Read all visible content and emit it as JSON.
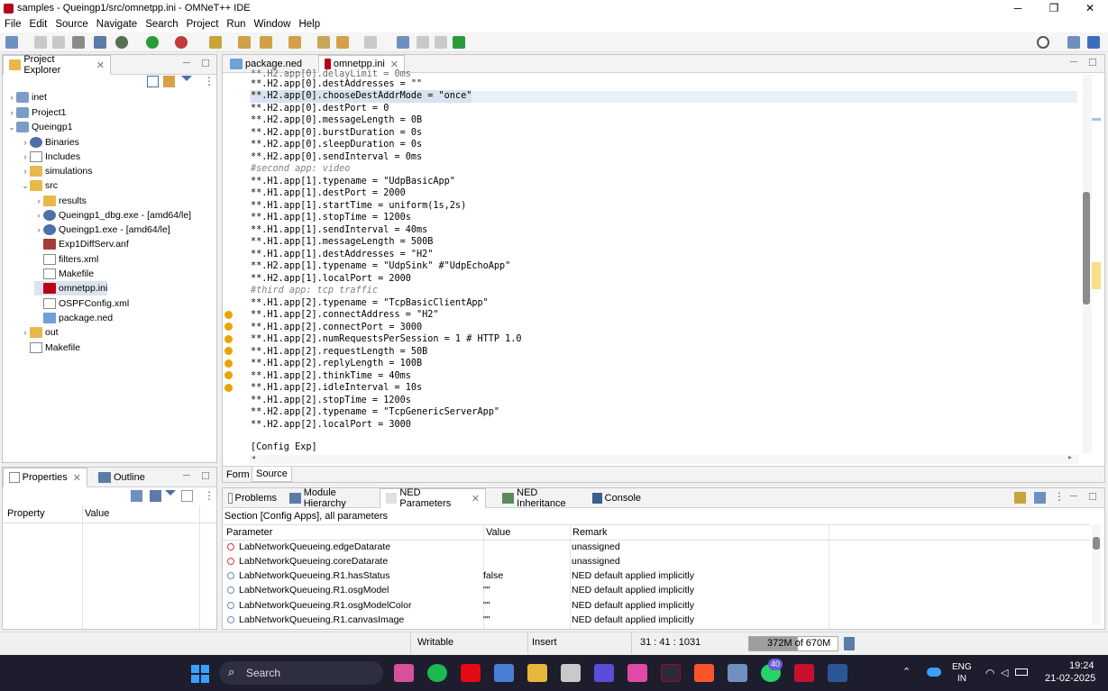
{
  "window": {
    "title": "samples - Queingp1/src/omnetpp.ini - OMNeT++ IDE",
    "minimize": "─",
    "maximize": "❐",
    "close": "✕"
  },
  "menu": [
    "File",
    "Edit",
    "Source",
    "Navigate",
    "Search",
    "Project",
    "Run",
    "Window",
    "Help"
  ],
  "project_explorer": {
    "tab_label": "Project Explorer",
    "items": [
      {
        "label": "inet",
        "arrow": "›"
      },
      {
        "label": "Project1",
        "arrow": "›"
      },
      {
        "label": "Queingp1",
        "arrow": "⌄"
      },
      {
        "label": "Binaries",
        "arrow": "›"
      },
      {
        "label": "Includes",
        "arrow": "›"
      },
      {
        "label": "simulations",
        "arrow": "›"
      },
      {
        "label": "src",
        "arrow": "⌄"
      },
      {
        "label": "results",
        "arrow": "›"
      },
      {
        "label": "Queingp1_dbg.exe - [amd64/le]",
        "arrow": "›"
      },
      {
        "label": "Queingp1.exe - [amd64/le]",
        "arrow": "›"
      },
      {
        "label": "Exp1DiffServ.anf",
        "arrow": ""
      },
      {
        "label": "filters.xml",
        "arrow": ""
      },
      {
        "label": "Makefile",
        "arrow": ""
      },
      {
        "label": "omnetpp.ini",
        "arrow": ""
      },
      {
        "label": "OSPFConfig.xml",
        "arrow": ""
      },
      {
        "label": "package.ned",
        "arrow": ""
      },
      {
        "label": "out",
        "arrow": "›"
      },
      {
        "label": "Makefile",
        "arrow": ""
      }
    ]
  },
  "properties": {
    "tab_label": "Properties",
    "outline_tab_label": "Outline",
    "col_property": "Property",
    "col_value": "Value"
  },
  "editor": {
    "tabs": [
      "package.ned",
      "omnetpp.ini"
    ],
    "bottom_tabs": [
      "Form",
      "Source"
    ],
    "lines": [
      "**.H2.app[0].destAddresses = \"\"",
      "**.H2.app[0].chooseDestAddrMode = \"once\"",
      "**.H2.app[0].destPort = 0",
      "**.H2.app[0].messageLength = 0B",
      "**.H2.app[0].burstDuration = 0s",
      "**.H2.app[0].sleepDuration = 0s",
      "**.H2.app[0].sendInterval = 0ms",
      "#second app: video",
      "**.H1.app[1].typename = \"UdpBasicApp\"",
      "**.H1.app[1].destPort = 2000",
      "**.H1.app[1].startTime = uniform(1s,2s)",
      "**.H1.app[1].stopTime = 1200s",
      "**.H1.app[1].sendInterval = 40ms",
      "**.H1.app[1].messageLength = 500B",
      "**.H1.app[1].destAddresses = \"H2\"",
      "**.H2.app[1].typename = \"UdpSink\" #\"UdpEchoApp\"",
      "**.H2.app[1].localPort = 2000",
      "#third app: tcp traffic",
      "**.H1.app[2].typename = \"TcpBasicClientApp\"",
      "**.H1.app[2].connectAddress = \"H2\"",
      "**.H1.app[2].connectPort = 3000",
      "**.H1.app[2].numRequestsPerSession = 1 # HTTP 1.0",
      "**.H1.app[2].requestLength = 50B",
      "**.H1.app[2].replyLength = 100B",
      "**.H1.app[2].thinkTime = 40ms",
      "**.H1.app[2].idleInterval = 10s",
      "**.H1.app[2].stopTime = 1200s",
      "**.H2.app[2].typename = \"TcpGenericServerApp\"",
      "**.H2.app[2].localPort = 3000",
      "",
      "[Config Exp]"
    ]
  },
  "bottom_panel": {
    "tabs": [
      "Problems",
      "Module Hierarchy",
      "NED Parameters",
      "NED Inheritance",
      "Console"
    ],
    "section_label": "Section [Config Apps], all parameters",
    "columns": [
      "Parameter",
      "Value",
      "Remark"
    ],
    "rows": [
      {
        "param": "LabNetworkQueueing.edgeDatarate",
        "value": "",
        "remark": "unassigned",
        "status": "red"
      },
      {
        "param": "LabNetworkQueueing.coreDatarate",
        "value": "",
        "remark": "unassigned",
        "status": "red"
      },
      {
        "param": "LabNetworkQueueing.R1.hasStatus",
        "value": "false",
        "remark": "NED default applied implicitly",
        "status": "blue"
      },
      {
        "param": "LabNetworkQueueing.R1.osgModel",
        "value": "\"\"",
        "remark": "NED default applied implicitly",
        "status": "blue"
      },
      {
        "param": "LabNetworkQueueing.R1.osgModelColor",
        "value": "\"\"",
        "remark": "NED default applied implicitly",
        "status": "blue"
      },
      {
        "param": "LabNetworkQueueing.R1.canvasImage",
        "value": "\"\"",
        "remark": "NED default applied implicitly",
        "status": "blue"
      }
    ]
  },
  "statusbar": {
    "mode": "Writable",
    "insert": "Insert",
    "position": "31 : 41 : 1031",
    "heap_used": "372M of 670M",
    "heap_used_fraction": 0.555
  },
  "taskbar": {
    "search_placeholder": "Search",
    "whatsapp_badge": "40",
    "lang": "ENG",
    "region": "IN",
    "time": "19:24",
    "date": "21-02-2025"
  }
}
